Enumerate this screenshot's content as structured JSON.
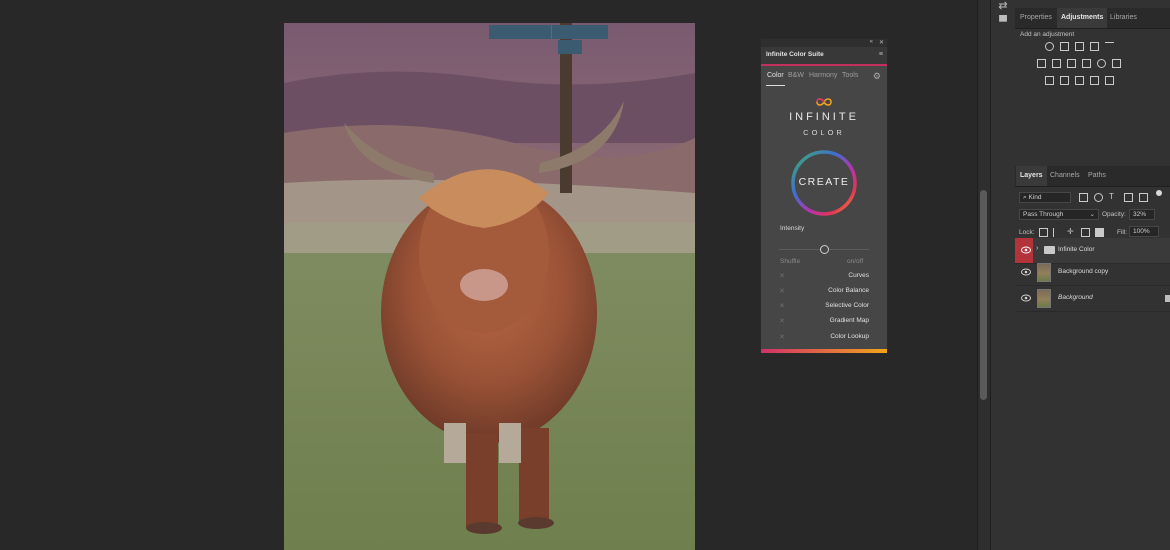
{
  "right_panels": {
    "adjustments_tabs": [
      "Properties",
      "Adjustments",
      "Libraries"
    ],
    "add_adjustment_label": "Add an adjustment",
    "layers_tabs": [
      "Layers",
      "Channels",
      "Paths"
    ],
    "filter_kind": "Kind",
    "blend_mode": "Pass Through",
    "opacity_label": "Opacity:",
    "opacity_value": "32%",
    "lock_label": "Lock:",
    "fill_label": "Fill:",
    "fill_value": "100%",
    "layers": [
      {
        "name": "Infinite Color",
        "type": "group"
      },
      {
        "name": "Background copy",
        "type": "image"
      },
      {
        "name": "Background",
        "type": "image"
      }
    ]
  },
  "plugin_panel": {
    "title": "Infinite Color Suite",
    "tabs": [
      "Color",
      "B&W",
      "Harmony",
      "Tools"
    ],
    "logo_line1": "INFINITE",
    "logo_line2": "COLOR",
    "create_label": "CREATE",
    "intensity_label": "Intensity",
    "intensity_value": 0.5,
    "shuffle_label": "Shuffle",
    "onoff_label": "on/off",
    "options": [
      "Curves",
      "Color Balance",
      "Selective Color",
      "Gradient Map",
      "Color Lookup"
    ]
  },
  "colors": {
    "accent_pink": "#c4305e",
    "accent_orange": "#f2a51a",
    "eye_active_bg": "#b3333a"
  },
  "icons": [
    "collapse-icon",
    "close-icon",
    "menu-icon",
    "gear-icon",
    "eye-icon",
    "folder-icon",
    "chevron-right-icon",
    "lock-icon",
    "comment-icon"
  ]
}
